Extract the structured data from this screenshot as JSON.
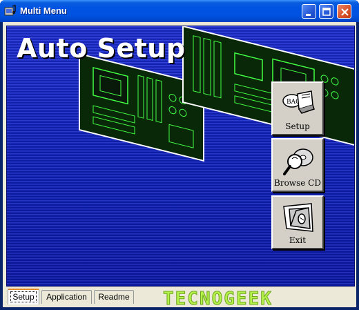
{
  "window": {
    "title": "Multi Menu",
    "app_icon": "multimedia-note-icon",
    "controls": {
      "minimize_icon": "minimize-icon",
      "maximize_icon": "maximize-icon",
      "close_icon": "close-icon"
    }
  },
  "banner": {
    "title": "Auto Setup",
    "background_color": "#1123c8",
    "artwork": "motherboard-illustration"
  },
  "menu": {
    "buttons": [
      {
        "label": "Setup",
        "icon": "setup-hdd-icon"
      },
      {
        "label": "Browse CD",
        "icon": "browse-cd-magnifier-icon"
      },
      {
        "label": "Exit",
        "icon": "exit-door-icon"
      }
    ]
  },
  "tabs": [
    {
      "label": "Setup",
      "active": true
    },
    {
      "label": "Application",
      "active": false
    },
    {
      "label": "Readme",
      "active": false
    }
  ],
  "watermark": {
    "text": "TECNOGEEK",
    "color": "#b6f04a"
  },
  "colors": {
    "titlebar": "#0054e3",
    "close_button": "#d9542b",
    "tab_highlight": "#e68b2c"
  }
}
